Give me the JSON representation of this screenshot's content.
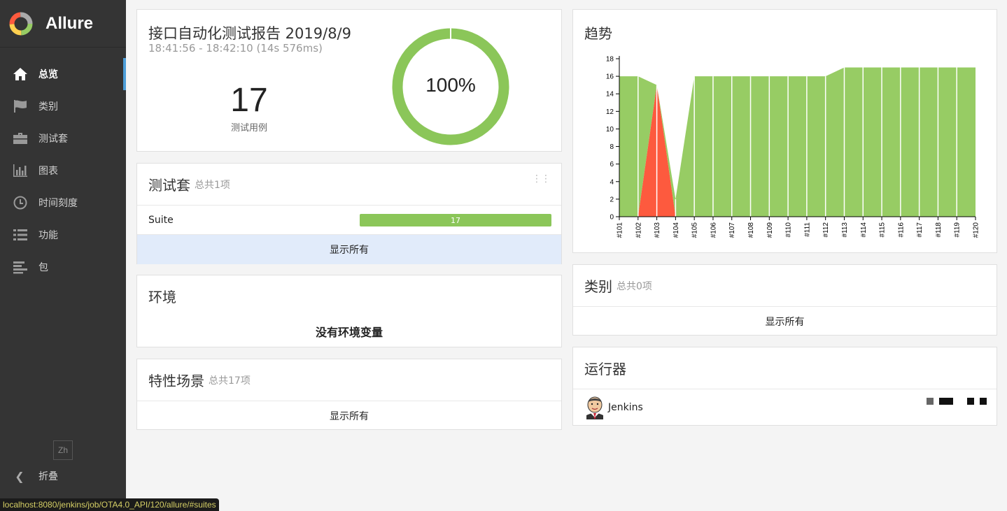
{
  "brand": {
    "name": "Allure"
  },
  "sidebar": {
    "items": [
      {
        "label": "总览",
        "icon": "home-icon",
        "active": true
      },
      {
        "label": "类别",
        "icon": "flag-icon"
      },
      {
        "label": "测试套",
        "icon": "briefcase-icon"
      },
      {
        "label": "图表",
        "icon": "bar-chart-icon"
      },
      {
        "label": "时间刻度",
        "icon": "clock-icon"
      },
      {
        "label": "功能",
        "icon": "list-icon"
      },
      {
        "label": "包",
        "icon": "align-left-icon"
      }
    ],
    "language": "Zh",
    "collapse_label": "折叠"
  },
  "summary": {
    "title": "接口自动化测试报告 2019/8/9",
    "time_range": "18:41:56 - 18:42:10 (14s 576ms)",
    "count": "17",
    "count_label": "测试用例",
    "pass_rate": "100%",
    "pass_fraction": 1.0
  },
  "suites": {
    "title": "测试套",
    "subtitle": "总共1项",
    "rows": [
      {
        "name": "Suite",
        "count": "17"
      }
    ],
    "show_all": "显示所有"
  },
  "environment": {
    "title": "环境",
    "empty": "没有环境变量"
  },
  "features": {
    "title": "特性场景",
    "subtitle": "总共17项",
    "show_all": "显示所有"
  },
  "trend": {
    "title": "趋势"
  },
  "categories": {
    "title": "类别",
    "subtitle": "总共0项",
    "show_all": "显示所有"
  },
  "executors": {
    "title": "运行器",
    "name": "Jenkins"
  },
  "statusbar": {
    "url": "localhost:8080/jenkins/job/OTA4.0_API/120/allure/#suites"
  },
  "colors": {
    "passed": "#97cc64",
    "failed": "#fd5a3e",
    "accent": "#4e9ed8"
  },
  "chart_data": {
    "type": "area",
    "categories": [
      "#101",
      "#102",
      "#103",
      "#104",
      "#105",
      "#106",
      "#107",
      "#108",
      "#109",
      "#110",
      "#111",
      "#112",
      "#113",
      "#114",
      "#115",
      "#116",
      "#117",
      "#118",
      "#119",
      "#120"
    ],
    "series": [
      {
        "name": "passed",
        "values": [
          16,
          16,
          0,
          2,
          16,
          16,
          16,
          16,
          16,
          16,
          16,
          16,
          17,
          17,
          17,
          17,
          17,
          17,
          17,
          17
        ]
      },
      {
        "name": "failed",
        "values": [
          0,
          0,
          15,
          0,
          0,
          0,
          0,
          0,
          0,
          0,
          0,
          0,
          0,
          0,
          0,
          0,
          0,
          0,
          0,
          0
        ]
      }
    ],
    "yticks": [
      0,
      2,
      4,
      6,
      8,
      10,
      12,
      14,
      16,
      18
    ],
    "ylim": [
      0,
      18
    ],
    "grid": false
  }
}
